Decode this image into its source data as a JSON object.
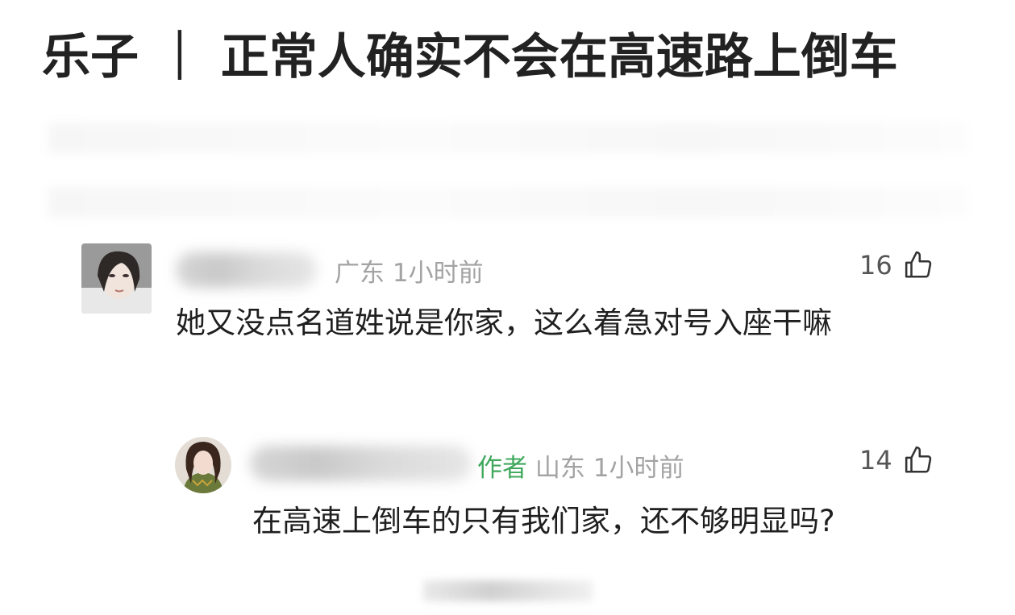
{
  "post": {
    "title": "乐子 ｜ 正常人确实不会在高速路上倒车"
  },
  "comments": [
    {
      "avatar": "user-avatar",
      "location": "广东",
      "time": "1小时前",
      "likes": "16",
      "like_icon": "thumbs-up-icon",
      "text": "她又没点名道姓说是你家，这么着急对号入座干嘛"
    },
    {
      "avatar": "author-avatar",
      "author_tag": "作者",
      "location": "山东",
      "time": "1小时前",
      "likes": "14",
      "like_icon": "thumbs-up-icon",
      "text": "在高速上倒车的只有我们家，还不够明显吗?"
    }
  ],
  "colors": {
    "author_tag": "#3fa85c",
    "meta": "#a3a3a3",
    "title": "#222222"
  }
}
